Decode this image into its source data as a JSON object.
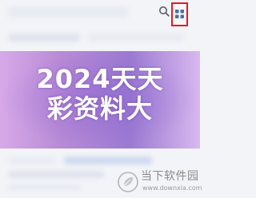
{
  "toolbar": {
    "search_icon": "search-icon",
    "menu_icon": "grid-icon",
    "highlight_color": "#e11b22"
  },
  "banner": {
    "line1": "2024天天",
    "line2": "彩资料大",
    "gradient_colors": [
      "#d7a9e8",
      "#9b7ad2",
      "#d8b8ee"
    ]
  },
  "watermark": {
    "name": "当下软件园",
    "url": "www.downxia.com",
    "logo_icon": "leaf-logo-icon"
  }
}
